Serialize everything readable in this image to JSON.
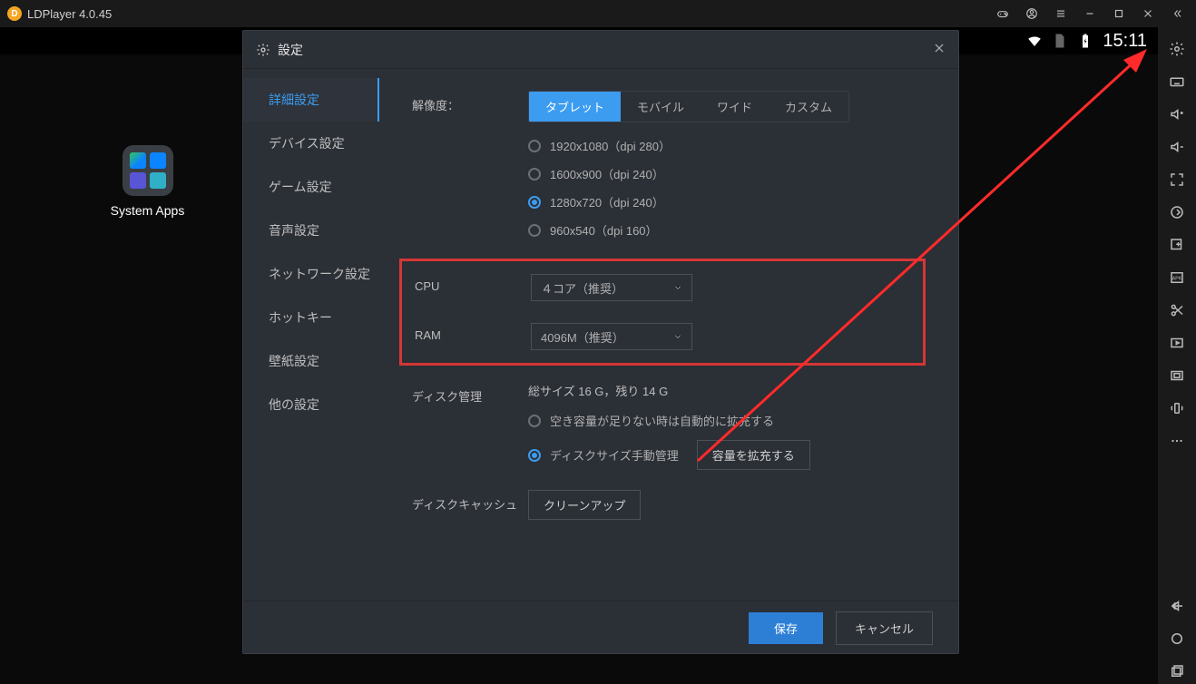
{
  "titlebar": {
    "title": "LDPlayer 4.0.45"
  },
  "status": {
    "time": "15:11"
  },
  "desktop": {
    "app_label": "System Apps"
  },
  "dialog": {
    "title": "設定",
    "nav": [
      "詳細設定",
      "デバイス設定",
      "ゲーム設定",
      "音声設定",
      "ネットワーク設定",
      "ホットキー",
      "壁紙設定",
      "他の設定"
    ],
    "resolution_label": "解像度：",
    "res_tabs": [
      "タブレット",
      "モバイル",
      "ワイド",
      "カスタム"
    ],
    "res_options": [
      "1920x1080（dpi 280）",
      "1600x900（dpi 240）",
      "1280x720（dpi 240）",
      "960x540（dpi 160）"
    ],
    "cpu_label": "CPU",
    "cpu_value": "４コア（推奨）",
    "ram_label": "RAM",
    "ram_value": "4096M（推奨）",
    "disk_label": "ディスク管理",
    "disk_info": "総サイズ 16 G，残り 14 G",
    "disk_opt_auto": "空き容量が足りない時は自動的に拡充する",
    "disk_opt_manual": "ディスクサイズ手動管理",
    "disk_expand_btn": "容量を拡充する",
    "cache_label": "ディスクキャッシュ",
    "cache_btn": "クリーンアップ",
    "save_btn": "保存",
    "cancel_btn": "キャンセル"
  }
}
